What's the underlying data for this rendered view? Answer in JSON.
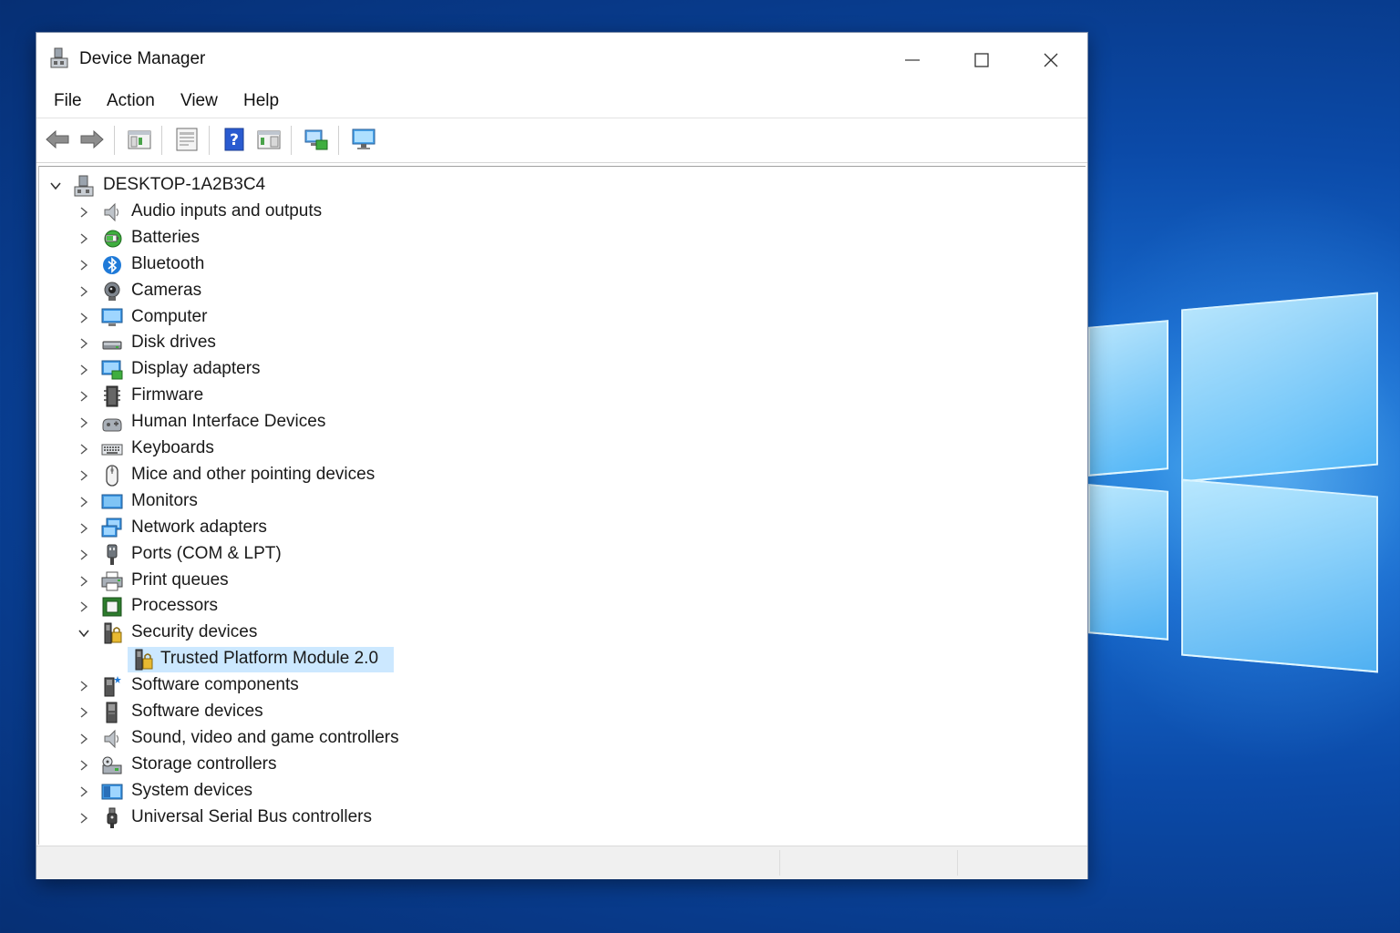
{
  "window": {
    "title": "Device Manager",
    "controls": {
      "minimize": "minimize",
      "maximize": "maximize",
      "close": "close"
    }
  },
  "menu": [
    "File",
    "Action",
    "View",
    "Help"
  ],
  "toolbar": {
    "buttons": [
      "back-icon",
      "forward-icon",
      "show-hide-console-tree-icon",
      "properties-icon",
      "help-icon",
      "action-pane-icon",
      "scan-hardware-icon",
      "monitor-icon"
    ]
  },
  "tree": {
    "root": {
      "label": "DESKTOP-1A2B3C4",
      "expanded": true
    },
    "items": [
      {
        "label": "Audio inputs and outputs",
        "icon": "speaker-icon"
      },
      {
        "label": "Batteries",
        "icon": "battery-icon"
      },
      {
        "label": "Bluetooth",
        "icon": "bluetooth-icon"
      },
      {
        "label": "Cameras",
        "icon": "camera-icon"
      },
      {
        "label": "Computer",
        "icon": "computer-icon"
      },
      {
        "label": "Disk drives",
        "icon": "disk-drive-icon"
      },
      {
        "label": "Display adapters",
        "icon": "display-adapter-icon"
      },
      {
        "label": "Firmware",
        "icon": "firmware-icon"
      },
      {
        "label": "Human Interface Devices",
        "icon": "hid-icon"
      },
      {
        "label": "Keyboards",
        "icon": "keyboard-icon"
      },
      {
        "label": "Mice and other pointing devices",
        "icon": "mouse-icon"
      },
      {
        "label": "Monitors",
        "icon": "monitor-icon"
      },
      {
        "label": "Network adapters",
        "icon": "network-adapter-icon"
      },
      {
        "label": "Ports (COM & LPT)",
        "icon": "port-icon"
      },
      {
        "label": "Print queues",
        "icon": "printer-icon"
      },
      {
        "label": "Processors",
        "icon": "processor-icon"
      },
      {
        "label": "Security devices",
        "icon": "security-device-icon",
        "expanded": true
      },
      {
        "label": "Trusted Platform Module 2.0",
        "icon": "tpm-icon",
        "child": true,
        "selected": true
      },
      {
        "label": "Software components",
        "icon": "software-component-icon"
      },
      {
        "label": "Software devices",
        "icon": "software-device-icon"
      },
      {
        "label": "Sound, video and game controllers",
        "icon": "speaker-icon"
      },
      {
        "label": "Storage controllers",
        "icon": "storage-controller-icon"
      },
      {
        "label": "System devices",
        "icon": "system-devices-icon"
      },
      {
        "label": "Universal Serial Bus controllers",
        "icon": "usb-icon"
      }
    ]
  },
  "colors": {
    "selection": "#cce8ff",
    "desktop": "#0b4aa8",
    "accent": "#1e7ad8"
  }
}
